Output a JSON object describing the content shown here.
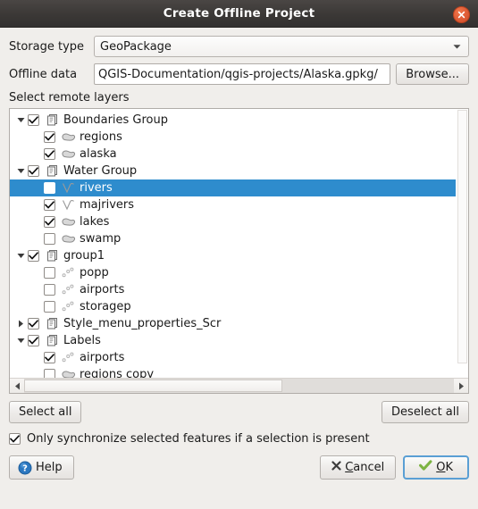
{
  "window": {
    "title": "Create Offline Project",
    "close_icon": "close-icon"
  },
  "form": {
    "storage_type_label": "Storage type",
    "storage_type_value": "GeoPackage",
    "offline_data_label": "Offline data",
    "offline_data_value": "/QGIS-Documentation/qgis-projects/Alaska.gpkg",
    "browse_label": "Browse..."
  },
  "tree": {
    "section_label": "Select remote layers",
    "rows": [
      {
        "label": "Boundaries Group",
        "level": 1,
        "type": "group",
        "checked": true,
        "expanded": true,
        "selected": false
      },
      {
        "label": "regions",
        "level": 2,
        "type": "polygon",
        "checked": true,
        "expanded": null,
        "selected": false
      },
      {
        "label": "alaska",
        "level": 2,
        "type": "polygon",
        "checked": true,
        "expanded": null,
        "selected": false
      },
      {
        "label": "Water Group",
        "level": 1,
        "type": "group",
        "checked": true,
        "expanded": true,
        "selected": false
      },
      {
        "label": "rivers",
        "level": 2,
        "type": "line",
        "checked": false,
        "expanded": null,
        "selected": true
      },
      {
        "label": "majrivers",
        "level": 2,
        "type": "line",
        "checked": true,
        "expanded": null,
        "selected": false
      },
      {
        "label": "lakes",
        "level": 2,
        "type": "polygon",
        "checked": true,
        "expanded": null,
        "selected": false
      },
      {
        "label": "swamp",
        "level": 2,
        "type": "polygon",
        "checked": false,
        "expanded": null,
        "selected": false
      },
      {
        "label": "group1",
        "level": 1,
        "type": "group",
        "checked": true,
        "expanded": true,
        "selected": false
      },
      {
        "label": "popp",
        "level": 2,
        "type": "point",
        "checked": false,
        "expanded": null,
        "selected": false
      },
      {
        "label": "airports",
        "level": 2,
        "type": "point",
        "checked": false,
        "expanded": null,
        "selected": false
      },
      {
        "label": "storagep",
        "level": 2,
        "type": "point",
        "checked": false,
        "expanded": null,
        "selected": false
      },
      {
        "label": "Style_menu_properties_Scr",
        "level": 1,
        "type": "group",
        "checked": true,
        "expanded": false,
        "selected": false
      },
      {
        "label": "Labels",
        "level": 1,
        "type": "group",
        "checked": true,
        "expanded": true,
        "selected": false
      },
      {
        "label": "airports",
        "level": 2,
        "type": "point",
        "checked": true,
        "expanded": null,
        "selected": false
      },
      {
        "label": "regions copy",
        "level": 2,
        "type": "polygon",
        "checked": false,
        "expanded": null,
        "selected": false
      }
    ]
  },
  "actions": {
    "select_all": "Select all",
    "deselect_all": "Deselect all",
    "only_sync_label": "Only synchronize selected features if a selection is present",
    "only_sync_checked": true
  },
  "footer": {
    "help_label": "Help",
    "cancel_mnemonic": "C",
    "cancel_rest": "ancel",
    "ok_mnemonic": "O",
    "ok_rest": "K"
  },
  "colors": {
    "selection_blue": "#2e8ccd",
    "titlebar": "#3b3836",
    "close_button": "#e2603a",
    "focus_blue": "#5a9fd4",
    "help_blue": "#2b77c0",
    "ok_green": "#7cb342"
  }
}
